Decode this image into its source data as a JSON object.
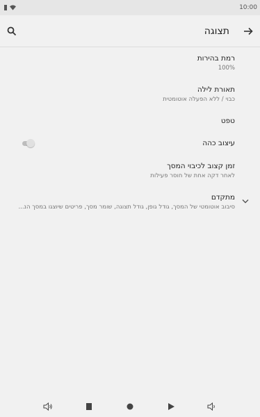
{
  "status_bar": {
    "time": "10:00"
  },
  "app_bar": {
    "title": "תצוגה"
  },
  "settings": [
    {
      "title": "רמת בהירות",
      "summary": "100%"
    },
    {
      "title": "תאורת לילה",
      "summary": "כבוי / ללא הפעלה אוטומטית"
    },
    {
      "title": "טפט",
      "summary": ""
    },
    {
      "title": "עיצוב כהה",
      "summary": ""
    },
    {
      "title": "זמן קצוב לכיבוי המסך",
      "summary": "לאחר דקה אחת של חוסר פעילות"
    },
    {
      "title": "מתקדם",
      "summary": "סיבוב אוטומטי של המסך, גודל גופן, גודל תצוגה, שומר מסך, פריטים שיוצגו במסך הנ..."
    }
  ],
  "icons": {
    "back": "arrow-right-icon",
    "search": "search-icon",
    "expand": "chevron-down-icon"
  },
  "colors": {
    "background": "#f1f1f1",
    "status_bar": "#e6e6e6",
    "toggle_off_track": "#bdbdbd"
  }
}
